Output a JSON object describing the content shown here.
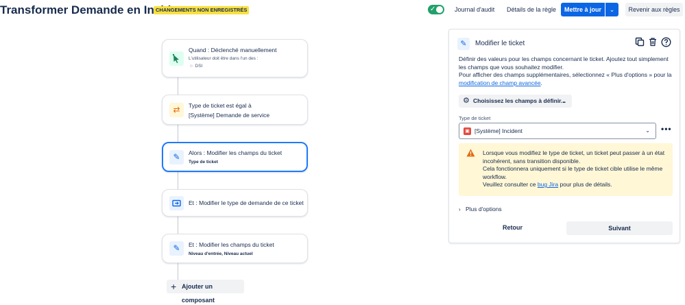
{
  "header": {
    "title": "Transformer Demande en Incident",
    "unsaved_badge": "CHANGEMENTS NON ENREGISTRÉS",
    "toggle_enabled": true,
    "audit_log": "Journal d'audit",
    "rule_details": "Détails de la règle",
    "update": "Mettre à jour",
    "revert": "Revenir aux règles"
  },
  "flow": {
    "trigger": {
      "title": "Quand : Déclenché manuellement",
      "subtitle": "L'utilisateur doit être dans l'un des :",
      "bullet": "DSI"
    },
    "condition": {
      "line1": "Type de ticket est égal à",
      "line2": "[Système] Demande de service"
    },
    "action1": {
      "title": "Alors : Modifier les champs du ticket",
      "subtitle": "Type de ticket"
    },
    "action2": {
      "title": "Et : Modifier le type de demande de ce ticket"
    },
    "action3": {
      "title": "Et : Modifier les champs du ticket",
      "subtitle": "Niveau d'entrée, Niveau actuel"
    },
    "add_component": "Ajouter un composant"
  },
  "panel": {
    "title": "Modifier le ticket",
    "desc1": "Définir des valeurs pour les champs concernant le ticket. Ajoutez tout simplement les champs que vous souhaitez modifier.",
    "desc2": "Pour afficher des champs supplémentaires, sélectionnez « Plus d'options » pour la",
    "desc_link": "modification de champ avancée",
    "desc_end": ".",
    "choose_fields": "Choisissez les champs à définir...",
    "field_label": "Type de ticket",
    "field_value": "[Système] Incident",
    "warning_line1": "Lorsque vous modifiez le type de ticket, un ticket peut passer à un état incohérent, sans transition disponible.",
    "warning_line2": "Cela fonctionnera uniquement si le type de ticket cible utilise le même workflow.",
    "warning_pre": "Veuillez consulter ce",
    "warning_link": "bug Jira",
    "warning_post": "pour plus de détails.",
    "more_options": "Plus d'options",
    "back": "Retour",
    "next": "Suivant"
  },
  "colors": {
    "primary": "#0c66e4",
    "badge": "#f8e040",
    "toggle": "#22a06b",
    "warning_bg": "#fff7d6",
    "selected_border": "#1d7afc"
  }
}
